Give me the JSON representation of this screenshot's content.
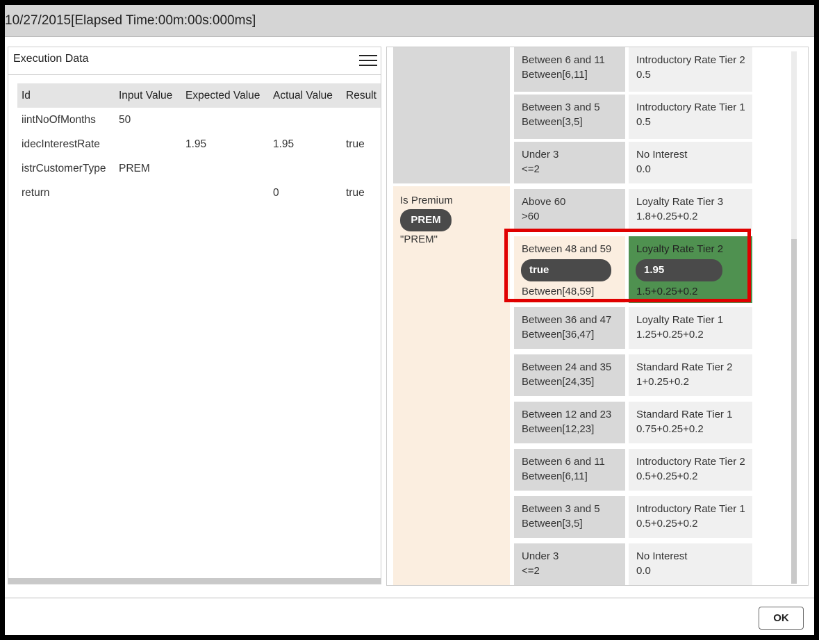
{
  "dialog": {
    "title": "10/27/2015[Elapsed Time:00m:00s:000ms]",
    "ok_label": "OK"
  },
  "execution_data": {
    "title": "Execution Data",
    "menu_icon": "hamburger-menu-icon",
    "columns": [
      "Id",
      "Input Value",
      "Expected Value",
      "Actual Value",
      "Result"
    ],
    "rows": [
      {
        "id": "iintNoOfMonths",
        "input": "50",
        "expected": "",
        "actual": "",
        "result": ""
      },
      {
        "id": "idecInterestRate",
        "input": "",
        "expected": "1.95",
        "actual": "1.95",
        "result": "true"
      },
      {
        "id": "istrCustomerType",
        "input": "PREM",
        "expected": "",
        "actual": "",
        "result": ""
      },
      {
        "id": "return",
        "input": "",
        "expected": "",
        "actual": "0",
        "result": "true"
      }
    ]
  },
  "decision_table": {
    "premium_condition": {
      "label": "Is Premium",
      "badge": "PREM",
      "value": "\"PREM\""
    },
    "rows": [
      {
        "key": "Between 6 and 11",
        "key_expr": "Between[6,11]",
        "val": "Introductory Rate Tier 2",
        "val_expr": "0.5"
      },
      {
        "key": "Between 3 and 5",
        "key_expr": "Between[3,5]",
        "val": "Introductory Rate Tier 1",
        "val_expr": "0.5"
      },
      {
        "key": "Under 3",
        "key_expr": "<=2",
        "val": "No Interest",
        "val_expr": "0.0"
      },
      {
        "key": "Above 60",
        "key_expr": ">60",
        "val": "Loyalty Rate Tier 3",
        "val_expr": "1.8+0.25+0.2"
      },
      {
        "key": "Between 48 and 59",
        "key_expr": "Between[48,59]",
        "key_badge": "true",
        "val": "Loyalty Rate Tier 2",
        "val_badge": "1.95",
        "val_expr": "1.5+0.25+0.2"
      },
      {
        "key": "Between 36 and 47",
        "key_expr": "Between[36,47]",
        "val": "Loyalty Rate Tier 1",
        "val_expr": "1.25+0.25+0.2"
      },
      {
        "key": "Between 24 and 35",
        "key_expr": "Between[24,35]",
        "val": "Standard Rate Tier 2",
        "val_expr": "1+0.25+0.2"
      },
      {
        "key": "Between 12 and 23",
        "key_expr": "Between[12,23]",
        "val": "Standard Rate Tier 1",
        "val_expr": "0.75+0.25+0.2"
      },
      {
        "key": "Between 6 and 11",
        "key_expr": "Between[6,11]",
        "val": "Introductory Rate Tier 2",
        "val_expr": "0.5+0.25+0.2"
      },
      {
        "key": "Between 3 and 5",
        "key_expr": "Between[3,5]",
        "val": "Introductory Rate Tier 1",
        "val_expr": "0.5+0.25+0.2"
      },
      {
        "key": "Under 3",
        "key_expr": "<=2",
        "val": "No Interest",
        "val_expr": "0.0"
      }
    ]
  },
  "colors": {
    "match_green": "#4f9150",
    "highlight_red": "#e00000",
    "active_condition": "#fbeee0",
    "badge": "#4a4a4a"
  }
}
